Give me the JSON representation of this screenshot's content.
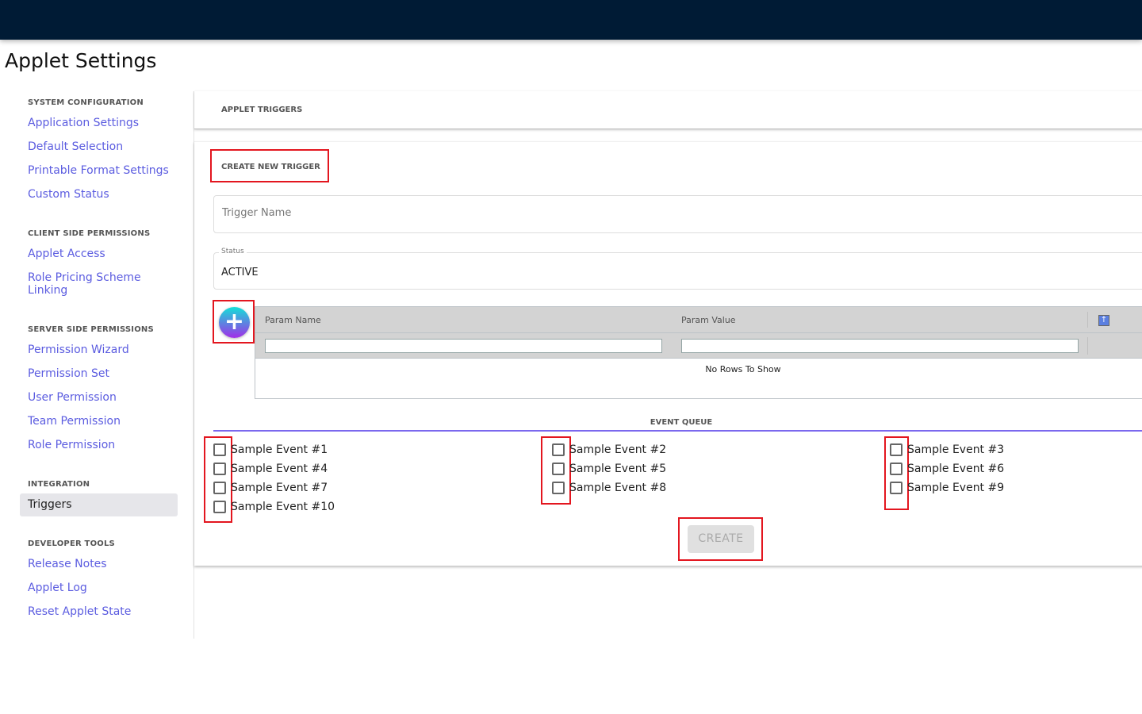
{
  "page_title": "Applet Settings",
  "sidebar": {
    "sections": [
      {
        "title": "SYSTEM CONFIGURATION",
        "items": [
          "Application Settings",
          "Default Selection",
          "Printable Format Settings",
          "Custom Status"
        ]
      },
      {
        "title": "CLIENT SIDE PERMISSIONS",
        "items": [
          "Applet Access",
          "Role Pricing Scheme Linking"
        ]
      },
      {
        "title": "SERVER SIDE PERMISSIONS",
        "items": [
          "Permission Wizard",
          "Permission Set",
          "User Permission",
          "Team Permission",
          "Role Permission"
        ]
      },
      {
        "title": "INTEGRATION",
        "items": [
          "Triggers"
        ]
      },
      {
        "title": "DEVELOPER TOOLS",
        "items": [
          "Release Notes",
          "Applet Log",
          "Reset Applet State"
        ]
      }
    ]
  },
  "main": {
    "header": "APPLET TRIGGERS",
    "create_title": "CREATE NEW TRIGGER",
    "trigger_name_placeholder": "Trigger Name",
    "status_label": "Status",
    "status_value": "ACTIVE",
    "grid": {
      "columns": [
        "Param Name",
        "Param Value"
      ],
      "empty_text": "No Rows To Show"
    },
    "event_queue_label": "EVENT QUEUE",
    "events": [
      "Sample Event #1",
      "Sample Event #2",
      "Sample Event #3",
      "Sample Event #4",
      "Sample Event #5",
      "Sample Event #6",
      "Sample Event #7",
      "Sample Event #8",
      "Sample Event #9",
      "Sample Event #10"
    ],
    "create_button": "CREATE"
  },
  "colors": {
    "topbar": "#001b35",
    "link": "#5b5ce0",
    "accent": "#7b68ee",
    "highlight": "#e3161f"
  }
}
